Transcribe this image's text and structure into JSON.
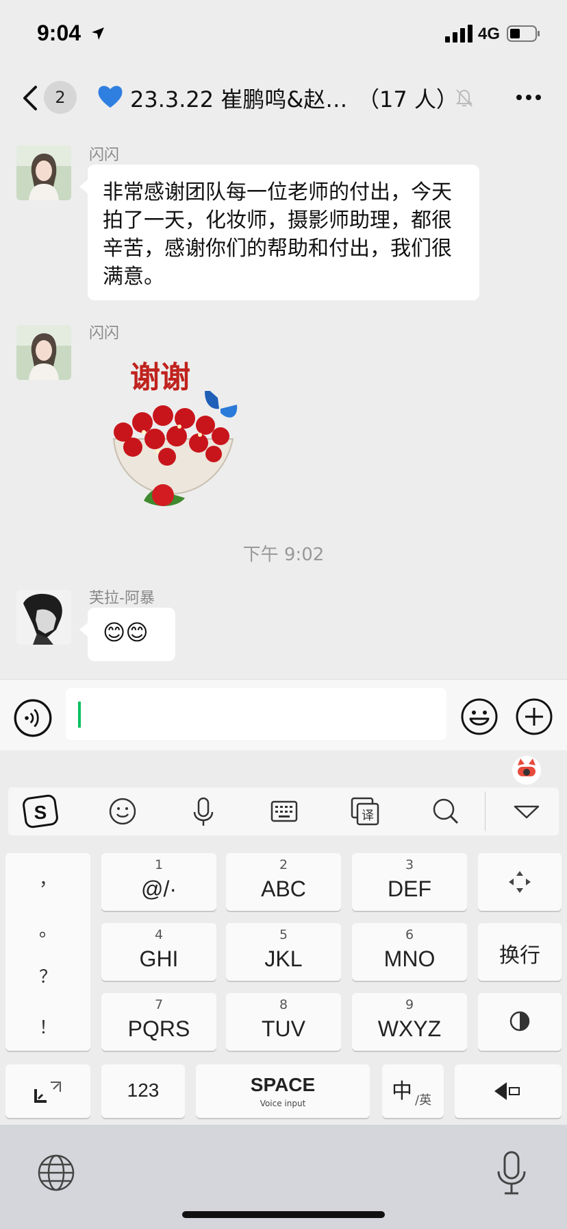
{
  "status_bar": {
    "time": "9:04",
    "network": "4G"
  },
  "header": {
    "unread_count": "2",
    "title": "23.3.22 崔鹏鸣&赵…",
    "member_count": "（17 人）"
  },
  "messages": [
    {
      "sender": "闪闪",
      "text": "非常感谢团队每一位老师的付出，今天拍了一天，化妆师，摄影师助理，都很辛苦，感谢你们的帮助和付出，我们很满意。"
    },
    {
      "sender": "闪闪",
      "sticker_text": "谢谢",
      "sticker": "roses-bouquet-with-butterfly"
    },
    {
      "timestamp": "下午 9:02"
    },
    {
      "sender": "芙拉-阿暴",
      "text": "😊😊"
    }
  ],
  "input_bar": {
    "value": ""
  },
  "keyboard": {
    "toolbar": [
      "sogou-logo-icon",
      "emoji-icon",
      "mic-icon",
      "keyboard-icon",
      "translate-icon",
      "search-icon",
      "collapse-icon"
    ],
    "punctuation": [
      "，",
      "。",
      "？",
      "！"
    ],
    "rows": [
      [
        {
          "num": "1",
          "label": "@/·"
        },
        {
          "num": "2",
          "label": "ABC"
        },
        {
          "num": "3",
          "label": "DEF"
        }
      ],
      [
        {
          "num": "4",
          "label": "GHI"
        },
        {
          "num": "5",
          "label": "JKL"
        },
        {
          "num": "6",
          "label": "MNO"
        }
      ],
      [
        {
          "num": "7",
          "label": "PQRS"
        },
        {
          "num": "8",
          "label": "TUV"
        },
        {
          "num": "9",
          "label": "WXYZ"
        }
      ]
    ],
    "return_label": "换行",
    "num_switch_label": "123",
    "space_label": "SPACE",
    "space_sub_label": "Voice input",
    "lang_main": "中",
    "lang_sub": "/英"
  },
  "colors": {
    "background": "#ededed",
    "bubble": "#ffffff",
    "accent_green": "#07c160"
  }
}
